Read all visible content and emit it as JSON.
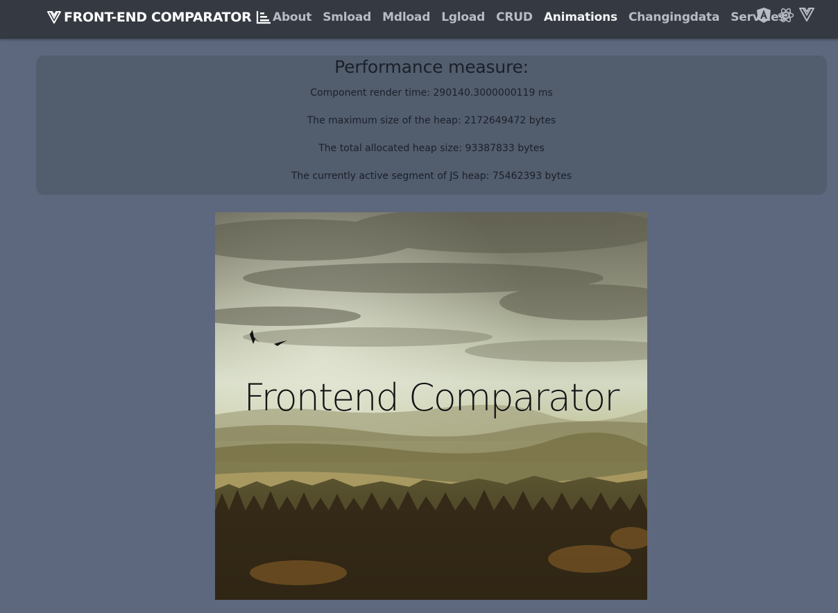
{
  "navbar": {
    "brand": "FRONT-END COMPARATOR",
    "links": [
      "About",
      "Smload",
      "Mdload",
      "Lgload",
      "CRUD",
      "Animations",
      "Changingdata",
      "Services"
    ],
    "active_link": "Animations",
    "framework_icons": [
      "angular-icon",
      "react-icon",
      "vue-icon"
    ]
  },
  "performance": {
    "title": "Performance measure:",
    "render_time": "Component render time: 290140.3000000119 ms",
    "heap_max": "The maximum size of the heap: 2172649472 bytes",
    "heap_total": "The total allocated heap size: 93387833 bytes",
    "heap_active": "The currently active segment of JS heap: 75462393 bytes"
  },
  "hero": {
    "title": "Frontend Comparator"
  },
  "colors": {
    "page_background": "#5d687e",
    "navbar_background": "#353a42",
    "panel_background": "#525d6e"
  }
}
